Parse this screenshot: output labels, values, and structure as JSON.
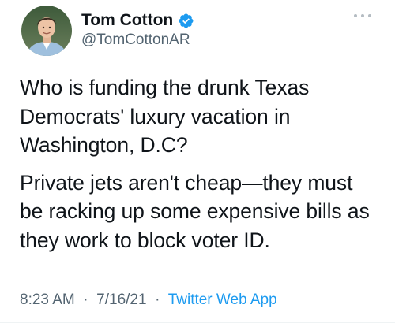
{
  "author": {
    "display_name": "Tom Cotton",
    "handle": "@TomCottonAR",
    "verified": true
  },
  "tweet": {
    "paragraphs": [
      "Who is funding the drunk Texas\nDemocrats' luxury vacation in\nWashington, D.C?",
      "Private jets aren't cheap—they must\nbe racking up some expensive bills as\nthey work to block voter ID."
    ]
  },
  "meta": {
    "time": "8:23 AM",
    "separator": "·",
    "date": "7/16/21",
    "source": "Twitter Web App"
  },
  "icons": {
    "verified": "verified-badge-icon",
    "more": "more-options-icon"
  },
  "colors": {
    "text_primary": "#0f1419",
    "text_secondary": "#536471",
    "accent": "#1d9bf0"
  }
}
